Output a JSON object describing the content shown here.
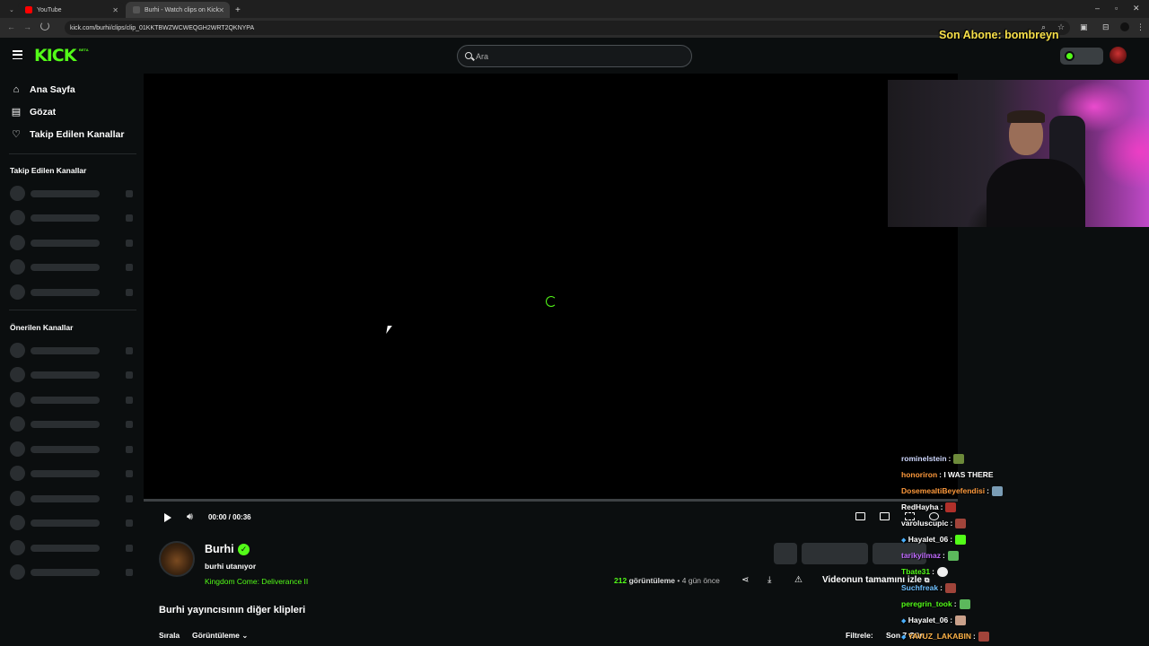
{
  "browser": {
    "tabs": [
      {
        "label": "YouTube",
        "active": false
      },
      {
        "label": "Burhi - Watch clips on Kick",
        "active": true
      }
    ],
    "url": "kick.com/burhi/clips/clip_01KKTBWZWCWEQGH2WRT2QKNYPA"
  },
  "header": {
    "logo": "KICK",
    "beta": "BETA",
    "search_placeholder": "Ara"
  },
  "sidebar": {
    "nav": [
      {
        "label": "Ana Sayfa",
        "icon": "home-icon"
      },
      {
        "label": "Gözat",
        "icon": "browse-icon"
      },
      {
        "label": "Takip Edilen Kanallar",
        "icon": "heart-icon"
      }
    ],
    "followed_title": "Takip Edilen Kanallar",
    "recommended_title": "Önerilen Kanallar"
  },
  "player": {
    "time": "00:00 / 00:36",
    "progress": 0
  },
  "clip": {
    "channel": "Burhi",
    "title": "burhi utanıyor",
    "category": "Kingdom Come: Deliverance II",
    "views_count": "212",
    "views_label": "görüntüleme",
    "age": "• 4 gün önce",
    "watch_full": "Videonun tamamını izle"
  },
  "more_clips": {
    "title": "Burhi yayıncısının diğer klipleri",
    "sort_label": "Sırala",
    "sort_value": "Görüntüleme",
    "filter_label": "Filtrele:",
    "filter_value": "Son 7 Gün"
  },
  "overlay": {
    "sub_alert": "Son Abone: bombreyn",
    "chat": [
      {
        "user": "rominelstein",
        "msg": ":",
        "color": "#cfd8ff"
      },
      {
        "user": "honoriron",
        "msg": ": I WAS THERE",
        "color": "#ff9a3c"
      },
      {
        "user": "DosemealtiBeyefendisi",
        "msg": ":",
        "color": "#ff9a3c"
      },
      {
        "user": "RedHayha",
        "msg": ":",
        "color": "#ffffff"
      },
      {
        "user": "varoluscupic",
        "msg": ":",
        "color": "#ffffff"
      },
      {
        "user": "Hayalet_06",
        "msg": ":",
        "color": "#ffffff"
      },
      {
        "user": "tarikyilmaz",
        "msg": ":",
        "color": "#c06bff"
      },
      {
        "user": "Tbate31",
        "msg": ":",
        "color": "#53fc18"
      },
      {
        "user": "Suchfreak",
        "msg": ":",
        "color": "#6fc0ff"
      },
      {
        "user": "peregrin_took",
        "msg": ":",
        "color": "#53fc18"
      },
      {
        "user": "Hayalet_06",
        "msg": ":",
        "color": "#ffffff"
      },
      {
        "user": "YAVUZ_LAKABIN",
        "msg": ":",
        "color": "#ffb347"
      }
    ]
  },
  "colors": {
    "accent": "#53fc18",
    "background": "#0b0e0f",
    "alert": "#f8e04a"
  }
}
